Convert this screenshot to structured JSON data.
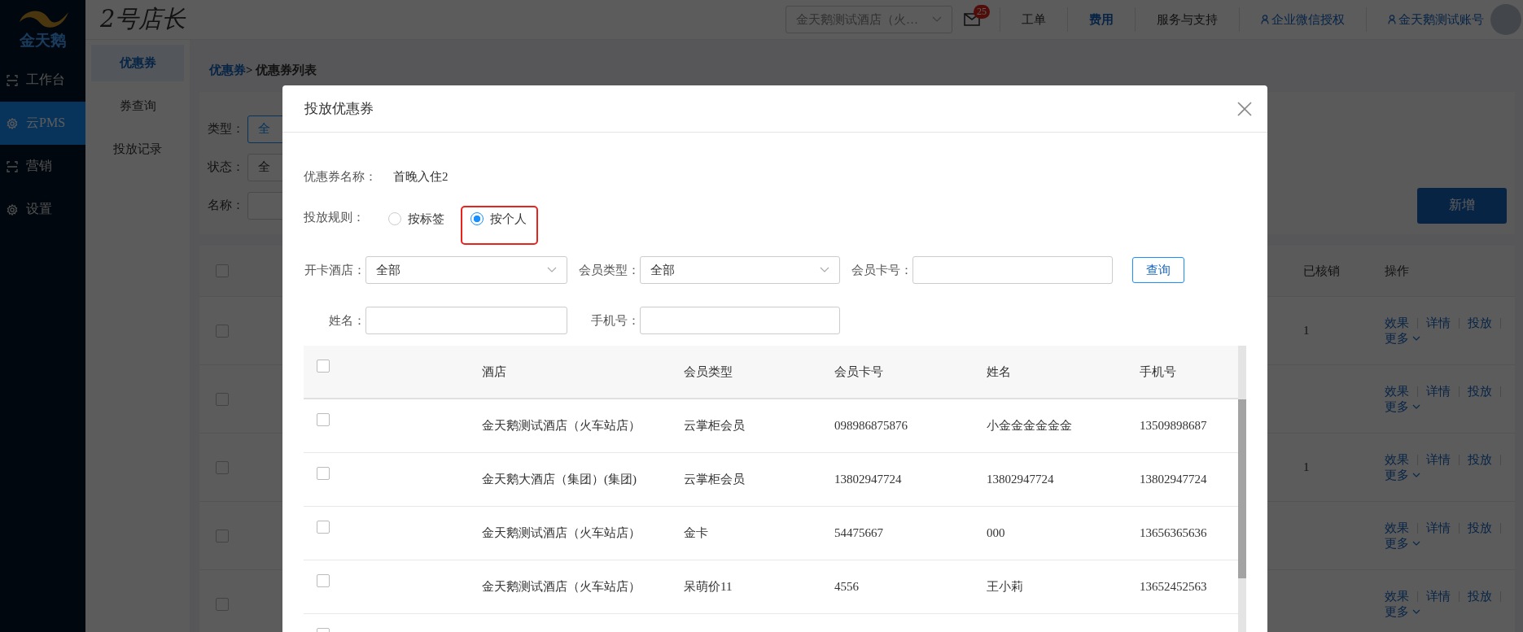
{
  "sidebar": {
    "logo_text": "金天鹅",
    "items": [
      {
        "label": "工作台",
        "kind": "scan",
        "selected": false
      },
      {
        "label": "云PMS",
        "kind": "gear",
        "selected": true
      },
      {
        "label": "营销",
        "kind": "scan",
        "selected": false
      },
      {
        "label": "设置",
        "kind": "gear",
        "selected": false
      }
    ]
  },
  "header": {
    "brand": "2号店长",
    "hotel_select": "金天鹅测试酒店（火…",
    "mail_badge": "25",
    "nav": [
      {
        "label": "工单",
        "kind": "text"
      },
      {
        "label": "费用",
        "kind": "link"
      },
      {
        "label": "服务与支持",
        "kind": "text"
      },
      {
        "label": "企业微信授权",
        "kind": "user"
      },
      {
        "label": "金天鹅测试账号",
        "kind": "user"
      }
    ]
  },
  "subnav": {
    "items": [
      {
        "label": "优惠券",
        "selected": true
      },
      {
        "label": "券查询",
        "selected": false
      },
      {
        "label": "投放记录",
        "selected": false
      }
    ]
  },
  "breadcrumb": {
    "link": "优惠券",
    "current": "> 优惠券列表"
  },
  "filters": [
    {
      "label": "类型：",
      "value": "全",
      "focused": true
    },
    {
      "label": "状态：",
      "value": "全",
      "focused": false
    },
    {
      "label": "名称：",
      "focused": false
    }
  ],
  "add_button": "新增",
  "coupon_table": {
    "columns": [
      "已核销",
      "操作"
    ],
    "header_checked": false,
    "rows": [
      {
        "checked": false,
        "verified": "1",
        "actions": [
          "效果",
          "详情",
          "投放"
        ],
        "more": "更多"
      },
      {
        "checked": false,
        "actions": [
          "效果",
          "详情",
          "投放"
        ],
        "more": "更多"
      },
      {
        "checked": false,
        "verified": "1",
        "actions": [
          "效果",
          "详情",
          "投放"
        ],
        "more": "更多"
      },
      {
        "checked": false,
        "actions": [
          "效果",
          "详情",
          "投放"
        ],
        "more": "更多"
      },
      {
        "checked": false,
        "actions": [
          "效果",
          "详情",
          "投放"
        ],
        "more": "更多"
      }
    ]
  },
  "modal": {
    "title": "投放优惠券",
    "coupon_name": {
      "label": "优惠券名称：",
      "value": "首晚入住2"
    },
    "rule": {
      "label": "投放规则：",
      "options": [
        {
          "label": "按标签",
          "selected": false,
          "highlighted": false
        },
        {
          "label": "按个人",
          "selected": true,
          "highlighted": true
        }
      ]
    },
    "field_rows": [
      {
        "fields": [
          {
            "label": "开卡酒店：",
            "kind": "select",
            "value": "全部"
          },
          {
            "label": "会员类型：",
            "kind": "select",
            "value": "全部"
          },
          {
            "label": "会员卡号：",
            "kind": "input"
          }
        ],
        "query_button": "查询"
      },
      {
        "fields": [
          {
            "label": "姓名：",
            "kind": "input"
          },
          {
            "label": "手机号：",
            "kind": "input"
          }
        ]
      }
    ],
    "table": {
      "columns": [
        "酒店",
        "会员类型",
        "会员卡号",
        "姓名",
        "手机号"
      ],
      "header_checked": false,
      "rows": [
        {
          "checked": false,
          "cells": [
            "金天鹅测试酒店（火车站店）",
            "云掌柜会员",
            "098986875876",
            "小金金金金金金",
            "13509898687"
          ]
        },
        {
          "checked": false,
          "cells": [
            "金天鹅大酒店（集团）(集团)",
            "云掌柜会员",
            "13802947724",
            "13802947724",
            "13802947724"
          ]
        },
        {
          "checked": false,
          "cells": [
            "金天鹅测试酒店（火车站店）",
            "金卡",
            "54475667",
            "000",
            "13656365636"
          ]
        },
        {
          "checked": false,
          "cells": [
            "金天鹅测试酒店（火车站店）",
            "呆萌价11",
            "4556",
            "王小莉",
            "13652452563"
          ]
        },
        {
          "checked": false
        }
      ]
    }
  }
}
